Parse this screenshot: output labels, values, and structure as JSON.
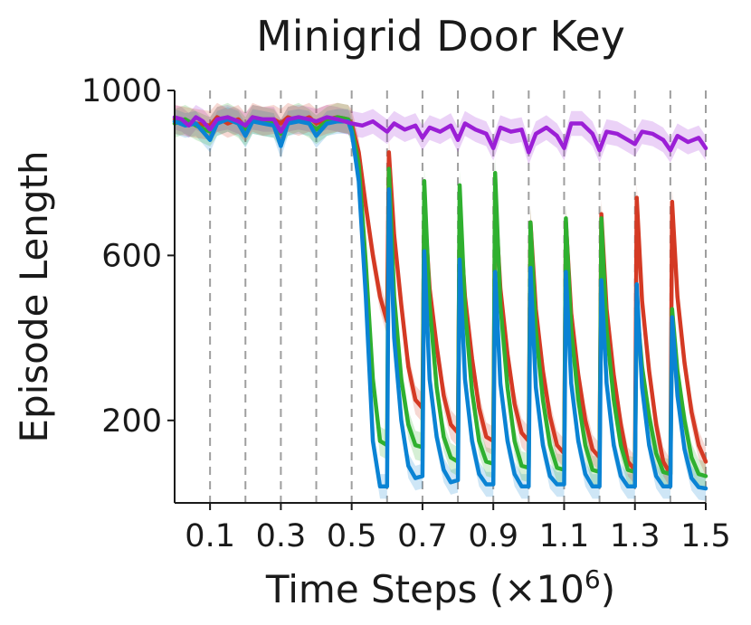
{
  "chart_data": {
    "type": "line",
    "title": "Minigrid Door Key",
    "xlabel": "Time Steps (×10",
    "xlabel_exponent": "6",
    "xlabel_close": ")",
    "ylabel": "Episode Length",
    "xlim": [
      0,
      1.5
    ],
    "ylim": [
      0,
      1000
    ],
    "xticks": [
      {
        "value": 0.1,
        "label": "0.1"
      },
      {
        "value": 0.3,
        "label": "0.3"
      },
      {
        "value": 0.5,
        "label": "0.5"
      },
      {
        "value": 0.7,
        "label": "0.7"
      },
      {
        "value": 0.9,
        "label": "0.9"
      },
      {
        "value": 1.1,
        "label": "1.1"
      },
      {
        "value": 1.3,
        "label": "1.3"
      },
      {
        "value": 1.5,
        "label": "1.5"
      }
    ],
    "yticks": [
      {
        "value": 1000,
        "label": "1000"
      },
      {
        "value": 600,
        "label": "600"
      },
      {
        "value": 200,
        "label": "200"
      }
    ],
    "task_switch_lines": [
      0.1,
      0.2,
      0.3,
      0.4,
      0.5,
      0.6,
      0.7,
      0.8,
      0.9,
      1.0,
      1.1,
      1.2,
      1.3,
      1.4,
      1.5
    ],
    "grid": false,
    "legend": "none",
    "series": [
      {
        "color": "#9b1fd6",
        "band": 30,
        "points": [
          [
            0,
            935
          ],
          [
            0.02,
            930
          ],
          [
            0.04,
            915
          ],
          [
            0.06,
            935
          ],
          [
            0.08,
            925
          ],
          [
            0.1,
            905
          ],
          [
            0.12,
            930
          ],
          [
            0.15,
            935
          ],
          [
            0.18,
            925
          ],
          [
            0.2,
            915
          ],
          [
            0.22,
            935
          ],
          [
            0.25,
            930
          ],
          [
            0.28,
            930
          ],
          [
            0.3,
            900
          ],
          [
            0.32,
            930
          ],
          [
            0.35,
            935
          ],
          [
            0.38,
            930
          ],
          [
            0.4,
            925
          ],
          [
            0.43,
            935
          ],
          [
            0.46,
            930
          ],
          [
            0.5,
            920
          ],
          [
            0.53,
            915
          ],
          [
            0.56,
            925
          ],
          [
            0.6,
            900
          ],
          [
            0.62,
            920
          ],
          [
            0.65,
            905
          ],
          [
            0.68,
            915
          ],
          [
            0.7,
            885
          ],
          [
            0.72,
            910
          ],
          [
            0.75,
            900
          ],
          [
            0.78,
            915
          ],
          [
            0.8,
            880
          ],
          [
            0.82,
            920
          ],
          [
            0.85,
            905
          ],
          [
            0.88,
            895
          ],
          [
            0.9,
            860
          ],
          [
            0.92,
            910
          ],
          [
            0.95,
            900
          ],
          [
            0.98,
            905
          ],
          [
            1.0,
            850
          ],
          [
            1.02,
            895
          ],
          [
            1.05,
            910
          ],
          [
            1.08,
            890
          ],
          [
            1.1,
            860
          ],
          [
            1.12,
            920
          ],
          [
            1.15,
            920
          ],
          [
            1.18,
            895
          ],
          [
            1.2,
            855
          ],
          [
            1.22,
            900
          ],
          [
            1.25,
            895
          ],
          [
            1.28,
            880
          ],
          [
            1.3,
            870
          ],
          [
            1.32,
            900
          ],
          [
            1.35,
            895
          ],
          [
            1.38,
            880
          ],
          [
            1.4,
            855
          ],
          [
            1.42,
            890
          ],
          [
            1.45,
            875
          ],
          [
            1.48,
            885
          ],
          [
            1.5,
            860
          ]
        ]
      },
      {
        "color": "#0a83d4",
        "band": 30,
        "points": [
          [
            0,
            925
          ],
          [
            0.03,
            915
          ],
          [
            0.06,
            920
          ],
          [
            0.1,
            880
          ],
          [
            0.12,
            920
          ],
          [
            0.15,
            930
          ],
          [
            0.18,
            920
          ],
          [
            0.2,
            890
          ],
          [
            0.22,
            925
          ],
          [
            0.25,
            920
          ],
          [
            0.28,
            915
          ],
          [
            0.3,
            865
          ],
          [
            0.32,
            920
          ],
          [
            0.35,
            925
          ],
          [
            0.38,
            920
          ],
          [
            0.4,
            890
          ],
          [
            0.43,
            920
          ],
          [
            0.46,
            925
          ],
          [
            0.49,
            925
          ],
          [
            0.5,
            900
          ],
          [
            0.52,
            780
          ],
          [
            0.54,
            500
          ],
          [
            0.56,
            150
          ],
          [
            0.58,
            40
          ],
          [
            0.6,
            40
          ],
          [
            0.605,
            760
          ],
          [
            0.62,
            400
          ],
          [
            0.64,
            200
          ],
          [
            0.66,
            90
          ],
          [
            0.68,
            60
          ],
          [
            0.7,
            65
          ],
          [
            0.705,
            610
          ],
          [
            0.72,
            300
          ],
          [
            0.74,
            160
          ],
          [
            0.76,
            80
          ],
          [
            0.78,
            50
          ],
          [
            0.8,
            55
          ],
          [
            0.805,
            590
          ],
          [
            0.82,
            300
          ],
          [
            0.84,
            150
          ],
          [
            0.86,
            70
          ],
          [
            0.88,
            45
          ],
          [
            0.9,
            45
          ],
          [
            0.905,
            560
          ],
          [
            0.92,
            290
          ],
          [
            0.94,
            150
          ],
          [
            0.96,
            70
          ],
          [
            0.98,
            40
          ],
          [
            1.0,
            40
          ],
          [
            1.005,
            570
          ],
          [
            1.02,
            280
          ],
          [
            1.04,
            140
          ],
          [
            1.06,
            65
          ],
          [
            1.08,
            45
          ],
          [
            1.1,
            45
          ],
          [
            1.105,
            560
          ],
          [
            1.12,
            290
          ],
          [
            1.14,
            150
          ],
          [
            1.16,
            70
          ],
          [
            1.18,
            40
          ],
          [
            1.2,
            40
          ],
          [
            1.205,
            540
          ],
          [
            1.22,
            290
          ],
          [
            1.24,
            140
          ],
          [
            1.26,
            65
          ],
          [
            1.28,
            40
          ],
          [
            1.3,
            40
          ],
          [
            1.305,
            530
          ],
          [
            1.32,
            280
          ],
          [
            1.34,
            140
          ],
          [
            1.36,
            65
          ],
          [
            1.38,
            40
          ],
          [
            1.4,
            40
          ],
          [
            1.405,
            450
          ],
          [
            1.42,
            260
          ],
          [
            1.44,
            130
          ],
          [
            1.46,
            60
          ],
          [
            1.48,
            38
          ],
          [
            1.5,
            35
          ]
        ]
      },
      {
        "color": "#2fb02f",
        "band": 35,
        "points": [
          [
            0,
            920
          ],
          [
            0.03,
            930
          ],
          [
            0.06,
            915
          ],
          [
            0.1,
            900
          ],
          [
            0.12,
            925
          ],
          [
            0.15,
            935
          ],
          [
            0.18,
            920
          ],
          [
            0.2,
            900
          ],
          [
            0.22,
            930
          ],
          [
            0.25,
            925
          ],
          [
            0.28,
            920
          ],
          [
            0.3,
            895
          ],
          [
            0.32,
            925
          ],
          [
            0.35,
            935
          ],
          [
            0.38,
            920
          ],
          [
            0.4,
            905
          ],
          [
            0.43,
            925
          ],
          [
            0.46,
            935
          ],
          [
            0.49,
            930
          ],
          [
            0.5,
            910
          ],
          [
            0.52,
            820
          ],
          [
            0.54,
            580
          ],
          [
            0.56,
            300
          ],
          [
            0.58,
            150
          ],
          [
            0.6,
            140
          ],
          [
            0.605,
            810
          ],
          [
            0.62,
            500
          ],
          [
            0.64,
            300
          ],
          [
            0.66,
            190
          ],
          [
            0.68,
            140
          ],
          [
            0.7,
            135
          ],
          [
            0.705,
            780
          ],
          [
            0.72,
            480
          ],
          [
            0.74,
            280
          ],
          [
            0.76,
            160
          ],
          [
            0.78,
            110
          ],
          [
            0.8,
            100
          ],
          [
            0.805,
            770
          ],
          [
            0.82,
            470
          ],
          [
            0.84,
            270
          ],
          [
            0.86,
            150
          ],
          [
            0.88,
            100
          ],
          [
            0.9,
            95
          ],
          [
            0.905,
            800
          ],
          [
            0.92,
            480
          ],
          [
            0.94,
            280
          ],
          [
            0.96,
            150
          ],
          [
            0.98,
            90
          ],
          [
            1.0,
            85
          ],
          [
            1.005,
            680
          ],
          [
            1.02,
            420
          ],
          [
            1.04,
            250
          ],
          [
            1.06,
            140
          ],
          [
            1.08,
            85
          ],
          [
            1.1,
            80
          ],
          [
            1.105,
            690
          ],
          [
            1.12,
            420
          ],
          [
            1.14,
            250
          ],
          [
            1.16,
            140
          ],
          [
            1.18,
            80
          ],
          [
            1.2,
            75
          ],
          [
            1.205,
            690
          ],
          [
            1.22,
            420
          ],
          [
            1.24,
            250
          ],
          [
            1.26,
            140
          ],
          [
            1.28,
            80
          ],
          [
            1.3,
            75
          ],
          [
            1.305,
            480
          ],
          [
            1.32,
            330
          ],
          [
            1.34,
            210
          ],
          [
            1.36,
            120
          ],
          [
            1.38,
            75
          ],
          [
            1.4,
            70
          ],
          [
            1.405,
            470
          ],
          [
            1.42,
            320
          ],
          [
            1.44,
            200
          ],
          [
            1.46,
            110
          ],
          [
            1.48,
            70
          ],
          [
            1.5,
            65
          ]
        ]
      },
      {
        "color": "#d43a24",
        "band": 35,
        "points": [
          [
            0,
            930
          ],
          [
            0.03,
            925
          ],
          [
            0.06,
            920
          ],
          [
            0.1,
            915
          ],
          [
            0.12,
            935
          ],
          [
            0.15,
            920
          ],
          [
            0.18,
            930
          ],
          [
            0.2,
            910
          ],
          [
            0.22,
            935
          ],
          [
            0.25,
            925
          ],
          [
            0.28,
            930
          ],
          [
            0.3,
            920
          ],
          [
            0.32,
            935
          ],
          [
            0.35,
            925
          ],
          [
            0.38,
            935
          ],
          [
            0.4,
            920
          ],
          [
            0.43,
            930
          ],
          [
            0.46,
            935
          ],
          [
            0.49,
            930
          ],
          [
            0.5,
            920
          ],
          [
            0.52,
            850
          ],
          [
            0.54,
            720
          ],
          [
            0.56,
            600
          ],
          [
            0.58,
            500
          ],
          [
            0.6,
            440
          ],
          [
            0.605,
            850
          ],
          [
            0.62,
            650
          ],
          [
            0.64,
            480
          ],
          [
            0.66,
            330
          ],
          [
            0.68,
            250
          ],
          [
            0.7,
            230
          ],
          [
            0.705,
            720
          ],
          [
            0.72,
            520
          ],
          [
            0.74,
            380
          ],
          [
            0.76,
            260
          ],
          [
            0.78,
            190
          ],
          [
            0.8,
            170
          ],
          [
            0.805,
            700
          ],
          [
            0.82,
            500
          ],
          [
            0.84,
            350
          ],
          [
            0.86,
            230
          ],
          [
            0.88,
            160
          ],
          [
            0.9,
            150
          ],
          [
            0.905,
            740
          ],
          [
            0.92,
            520
          ],
          [
            0.94,
            360
          ],
          [
            0.96,
            240
          ],
          [
            0.98,
            170
          ],
          [
            1.0,
            150
          ],
          [
            1.005,
            680
          ],
          [
            1.02,
            470
          ],
          [
            1.04,
            320
          ],
          [
            1.06,
            210
          ],
          [
            1.08,
            140
          ],
          [
            1.1,
            120
          ],
          [
            1.105,
            680
          ],
          [
            1.12,
            460
          ],
          [
            1.14,
            310
          ],
          [
            1.16,
            200
          ],
          [
            1.18,
            130
          ],
          [
            1.2,
            110
          ],
          [
            1.205,
            700
          ],
          [
            1.22,
            470
          ],
          [
            1.24,
            310
          ],
          [
            1.26,
            190
          ],
          [
            1.28,
            100
          ],
          [
            1.3,
            80
          ],
          [
            1.305,
            740
          ],
          [
            1.32,
            490
          ],
          [
            1.34,
            320
          ],
          [
            1.36,
            190
          ],
          [
            1.38,
            100
          ],
          [
            1.4,
            70
          ],
          [
            1.405,
            730
          ],
          [
            1.42,
            500
          ],
          [
            1.44,
            340
          ],
          [
            1.46,
            220
          ],
          [
            1.48,
            140
          ],
          [
            1.5,
            100
          ]
        ]
      }
    ]
  }
}
